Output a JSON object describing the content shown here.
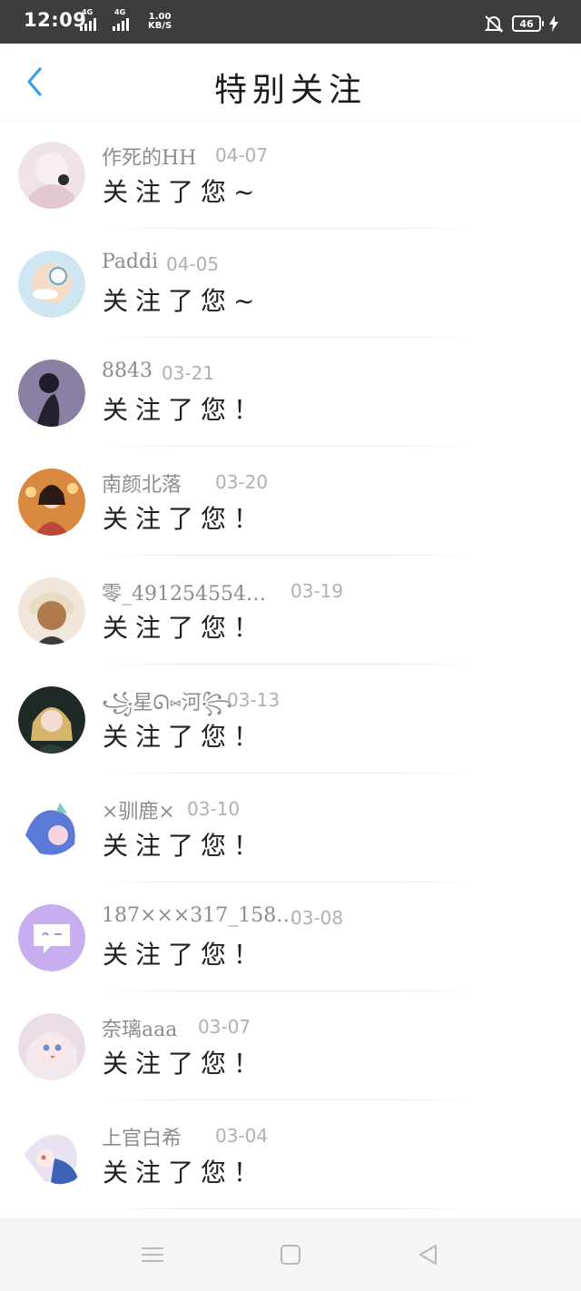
{
  "status_bar": {
    "time": "12:09",
    "signal_1": "4G",
    "signal_2": "4G",
    "speed_value": "1.00",
    "speed_unit": "KB/S",
    "battery": "46"
  },
  "header": {
    "title": "特别关注",
    "back_icon": "chevron-left-icon"
  },
  "items": [
    {
      "name": "作死的HH",
      "date": "04-07",
      "message": "关注了您~"
    },
    {
      "name": "Paddi",
      "date": "04-05",
      "message": "关注了您~"
    },
    {
      "name": "8843",
      "date": "03-21",
      "message": "关注了您！"
    },
    {
      "name": "南颜北落",
      "date": "03-20",
      "message": "关注了您！"
    },
    {
      "name": "零_491254554…",
      "date": "03-19",
      "message": "关注了您！"
    },
    {
      "name": "꧁星ᘏ⑅河꧂",
      "date": "03-13",
      "message": "关注了您！"
    },
    {
      "name": "×驯鹿×",
      "date": "03-10",
      "message": "关注了您！"
    },
    {
      "name": "187×××317_158…",
      "date": "03-08",
      "message": "关注了您！"
    },
    {
      "name": "奈璃aaa",
      "date": "03-07",
      "message": "关注了您！"
    },
    {
      "name": "上官白希",
      "date": "03-04",
      "message": "关注了您！"
    }
  ],
  "nav": {
    "menu_icon": "menu-icon",
    "home_icon": "home-square-icon",
    "back_icon": "back-triangle-icon"
  },
  "colors": {
    "accent": "#3a9ee8",
    "status_bar": "#3d3d3d"
  }
}
